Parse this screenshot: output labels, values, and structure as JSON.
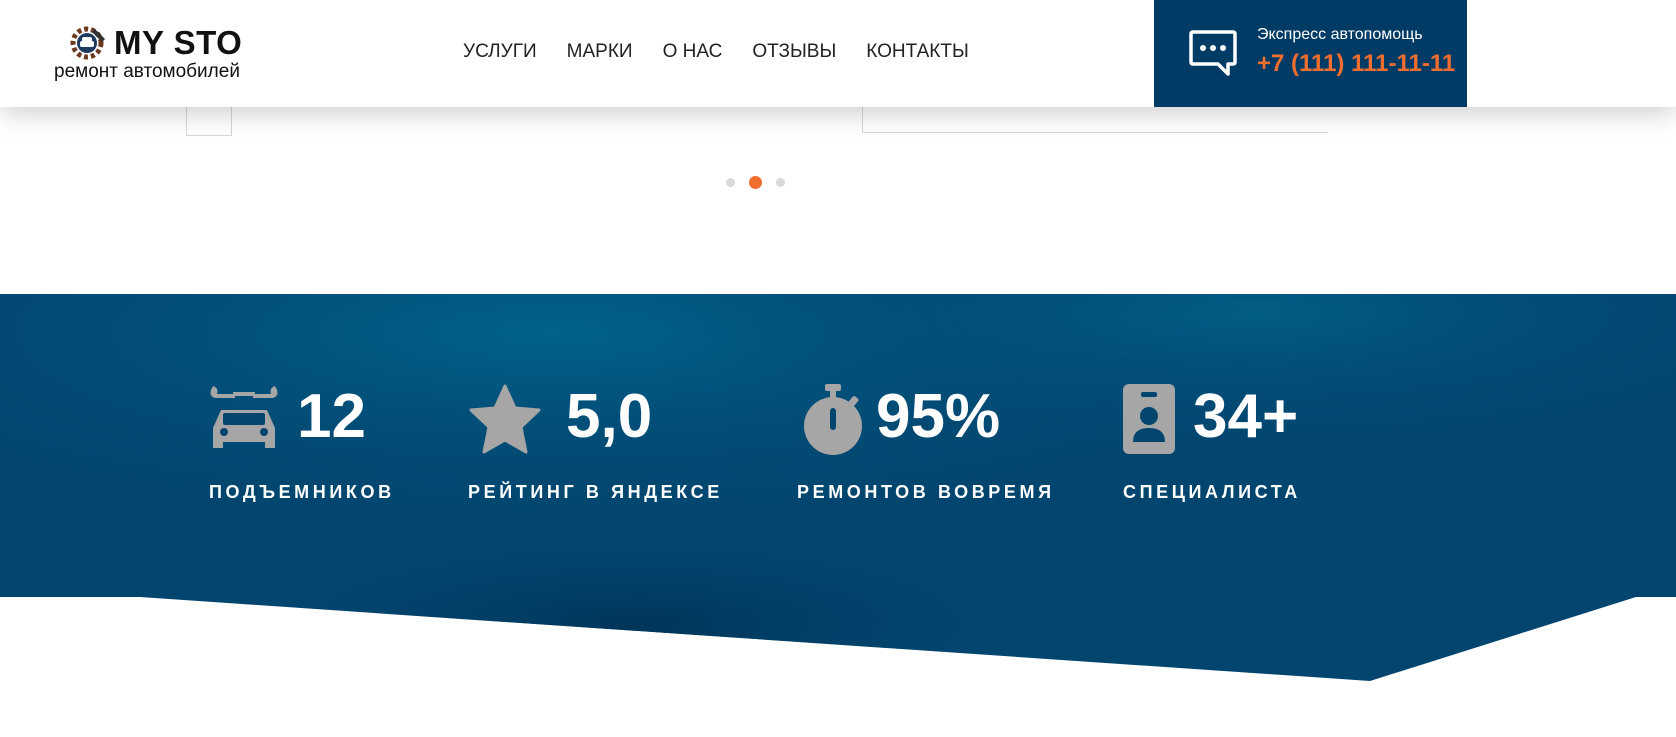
{
  "header": {
    "logo_title": "MY STO",
    "logo_subtitle": "ремонт автомобилей",
    "nav": [
      {
        "label": "УСЛУГИ"
      },
      {
        "label": "МАРКИ"
      },
      {
        "label": "О НАС"
      },
      {
        "label": "ОТЗЫВЫ"
      },
      {
        "label": "КОНТАКТЫ"
      }
    ],
    "express": {
      "label": "Экспресс автопомощь",
      "phone": "+7 (111) 111-11-11",
      "icon": "chat-bubble-icon"
    }
  },
  "slider": {
    "dots": 3,
    "active_dot": 2
  },
  "stats": [
    {
      "value": "12",
      "label": "ПОДЪЕМНИКОВ",
      "icon": "car-wrench-icon"
    },
    {
      "value": "5,0",
      "label": "РЕЙТИНГ В ЯНДЕКСЕ",
      "icon": "star-icon"
    },
    {
      "value": "95%",
      "label": "РЕМОНТОВ ВОВРЕМЯ",
      "icon": "stopwatch-icon"
    },
    {
      "value": "34+",
      "label": "СПЕЦИАЛИСТА",
      "icon": "id-badge-icon"
    }
  ],
  "colors": {
    "accent": "#ef6d2e",
    "brand_dark": "#003b66",
    "icon_gray": "#a6a6a6"
  }
}
